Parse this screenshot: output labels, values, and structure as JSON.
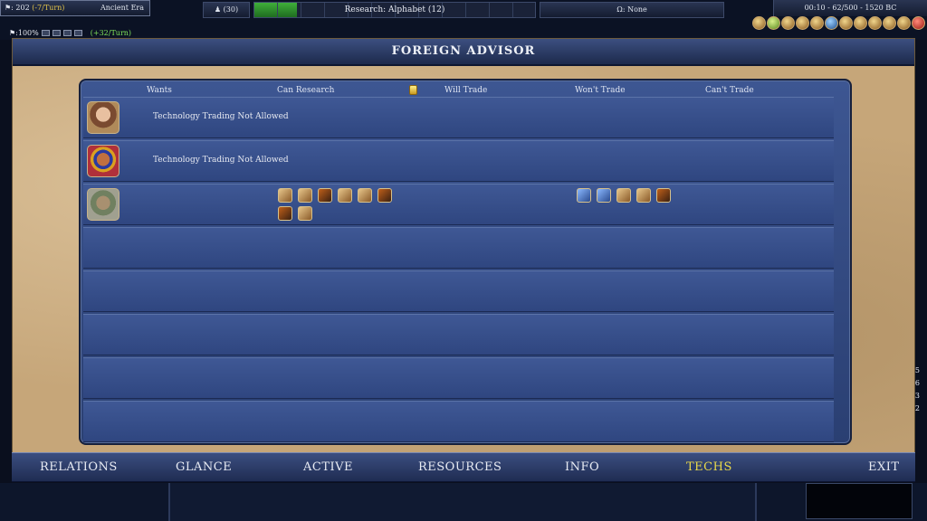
{
  "hud": {
    "gold_text": "⚑: 202",
    "gold_rate": "(-7/Turn)",
    "era": "Ancient Era",
    "pop_text": "(30)",
    "research_text": "Research: Alphabet (12)",
    "research_progress": 0.15,
    "great_person_text": "Ω: None",
    "time_text": "00:10 - 62/500 - 1520 BC",
    "rate_pct": "⚑:100%",
    "rate_turn": "(+32/Turn)",
    "side_numbers": [
      "5",
      "6",
      "3",
      "2"
    ]
  },
  "window": {
    "title": "FOREIGN ADVISOR"
  },
  "table": {
    "headers": {
      "wants": "Wants",
      "can_research": "Can Research",
      "will_trade": "Will Trade",
      "wont_trade": "Won't Trade",
      "cant_trade": "Can't Trade"
    },
    "rows": [
      {
        "leader": "leader-portrait-1",
        "message": "Technology Trading Not Allowed"
      },
      {
        "leader": "leader-portrait-2",
        "message": "Technology Trading Not Allowed"
      },
      {
        "leader": "leader-portrait-3",
        "message": ""
      }
    ]
  },
  "tabs": {
    "relations": "RELATIONS",
    "glance": "GLANCE",
    "active": "ACTIVE",
    "resources": "RESOURCES",
    "info": "INFO",
    "techs": "TECHS",
    "exit": "EXIT"
  },
  "colors": {
    "active_tab": "#e8d84a",
    "panel_blue": "#2f4680",
    "parchment": "#c6a679"
  }
}
